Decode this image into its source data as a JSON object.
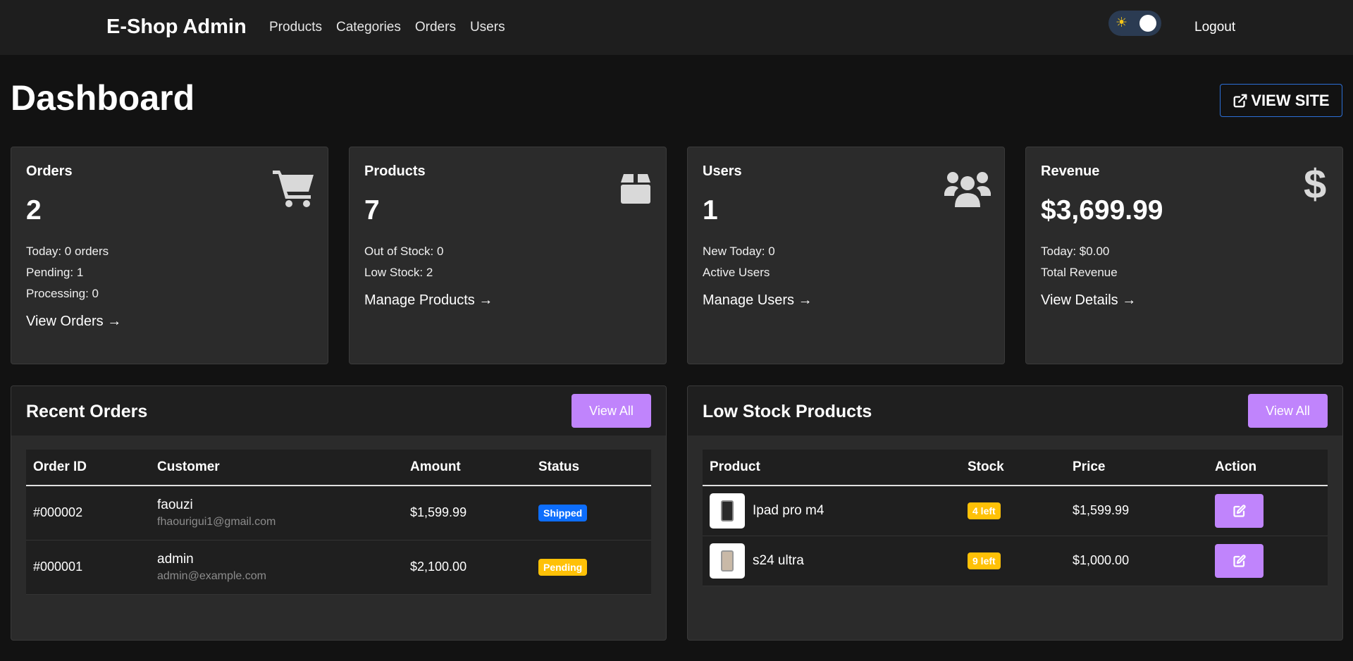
{
  "navbar": {
    "brand": "E-Shop Admin",
    "links": [
      "Products",
      "Categories",
      "Orders",
      "Users"
    ],
    "theme_icon": "sun-icon",
    "logout": "Logout"
  },
  "header": {
    "title": "Dashboard",
    "view_site": "VIEW SITE"
  },
  "cards": [
    {
      "title": "Orders",
      "value": "2",
      "lines": [
        "Today: 0 orders",
        "Pending: 1",
        "Processing: 0"
      ],
      "link": "View Orders →",
      "icon": "cart-icon"
    },
    {
      "title": "Products",
      "value": "7",
      "lines": [
        "Out of Stock: 0",
        "Low Stock: 2"
      ],
      "link": "Manage Products →",
      "icon": "box-icon"
    },
    {
      "title": "Users",
      "value": "1",
      "lines": [
        "New Today: 0",
        "Active Users"
      ],
      "link": "Manage Users →",
      "icon": "users-icon"
    },
    {
      "title": "Revenue",
      "value": "$3,699.99",
      "lines": [
        "Today: $0.00",
        "Total Revenue"
      ],
      "link": "View Details →",
      "icon": "dollar-icon"
    }
  ],
  "recent_orders": {
    "title": "Recent Orders",
    "view_all": "View All",
    "columns": [
      "Order ID",
      "Customer",
      "Amount",
      "Status"
    ],
    "rows": [
      {
        "id": "#000002",
        "name": "faouzi",
        "email": "fhaourigui1@gmail.com",
        "amount": "$1,599.99",
        "status": "Shipped"
      },
      {
        "id": "#000001",
        "name": "admin",
        "email": "admin@example.com",
        "amount": "$2,100.00",
        "status": "Pending"
      }
    ]
  },
  "low_stock": {
    "title": "Low Stock Products",
    "view_all": "View All",
    "columns": [
      "Product",
      "Stock",
      "Price",
      "Action"
    ],
    "rows": [
      {
        "name": "Ipad pro m4",
        "stock": "4 left",
        "price": "$1,599.99"
      },
      {
        "name": "s24 ultra",
        "stock": "9 left",
        "price": "$1,000.00"
      }
    ]
  },
  "colors": {
    "accent": "#c084fc",
    "shipped": "#0d6efd",
    "pending": "#ffc107",
    "view_site_border": "#2c6fd6"
  }
}
